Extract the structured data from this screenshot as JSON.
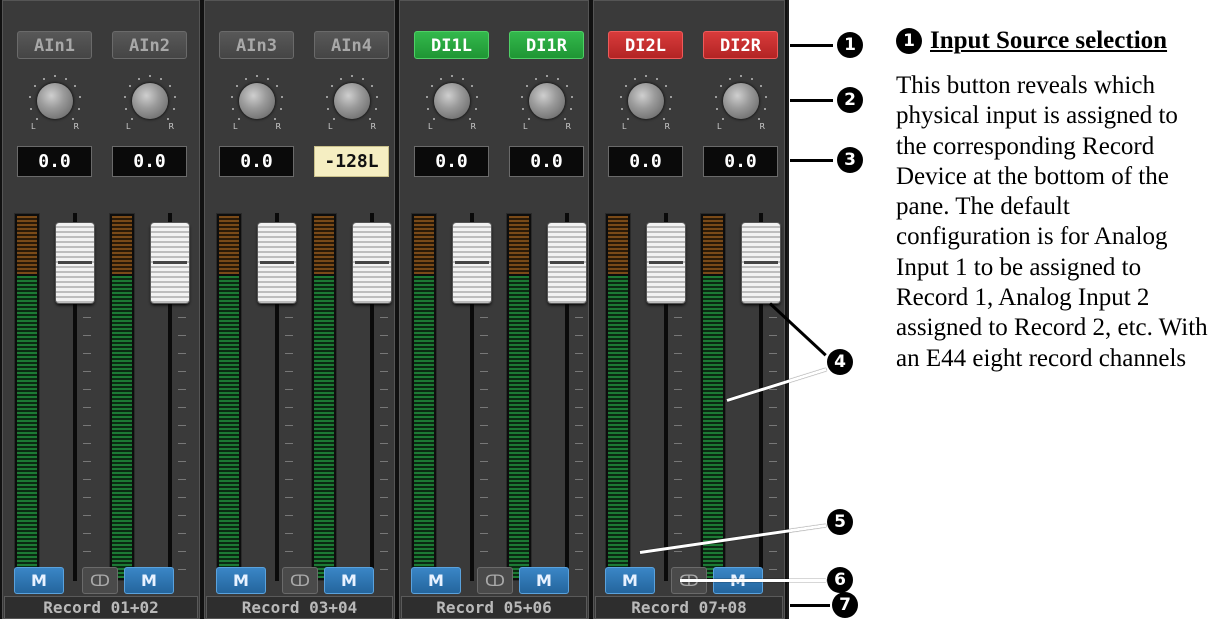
{
  "pairs": [
    {
      "sources": [
        "AIn1",
        "AIn2"
      ],
      "kind": "analog",
      "pan": [
        "0.0",
        "0.0"
      ],
      "link": "ↀ",
      "record": "Record 01+02"
    },
    {
      "sources": [
        "AIn3",
        "AIn4"
      ],
      "kind": "analog",
      "pan": [
        "0.0",
        "-128L"
      ],
      "link": "ↀ",
      "record": "Record 03+04"
    },
    {
      "sources": [
        "DI1L",
        "DI1R"
      ],
      "kind": "digital-a",
      "pan": [
        "0.0",
        "0.0"
      ],
      "link": "ↀ",
      "record": "Record 05+06"
    },
    {
      "sources": [
        "DI2L",
        "DI2R"
      ],
      "kind": "digital-b",
      "pan": [
        "0.0",
        "0.0"
      ],
      "link": "ↀ",
      "record": "Record 07+08"
    }
  ],
  "mute_label": "M",
  "knob_left": "L",
  "knob_right": "R",
  "callouts": [
    "1",
    "2",
    "3",
    "4",
    "5",
    "6",
    "7"
  ],
  "colors": {
    "analog": "#4c4c4c",
    "digital_a": "#2aa23e",
    "digital_b": "#c52d2d",
    "mute": "#2f78b5",
    "meter_green": "#1c7a34",
    "meter_hot": "#7a4a18"
  },
  "description": {
    "number": "1",
    "title": "Input Source selection",
    "text": "This button reveals which physical input is assigned to the corresponding Record Device at the bottom of the pane. The default configuration is for Analog Input 1 to be assigned to Record 1, Analog Input 2 assigned to Record 2, etc. With an E44 eight record channels"
  }
}
